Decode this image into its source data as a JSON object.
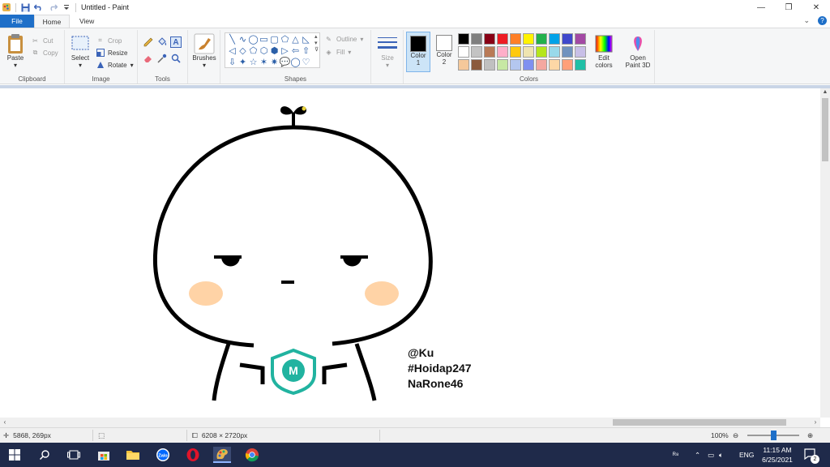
{
  "window": {
    "title": "Untitled - Paint",
    "controls": {
      "minimize": "—",
      "maximize": "❐",
      "close": "✕"
    }
  },
  "tabs": [
    {
      "label": "File"
    },
    {
      "label": "Home"
    },
    {
      "label": "View"
    }
  ],
  "ribbon": {
    "clipboard": {
      "label": "Clipboard",
      "paste": "Paste",
      "cut": "Cut",
      "copy": "Copy"
    },
    "image": {
      "label": "Image",
      "select": "Select",
      "crop": "Crop",
      "resize": "Resize",
      "rotate": "Rotate"
    },
    "tools": {
      "label": "Tools"
    },
    "brushes": {
      "label": "Brushes"
    },
    "shapes": {
      "label": "Shapes",
      "outline": "Outline",
      "fill": "Fill",
      "glyphs": [
        "╲",
        "∿",
        "◯",
        "▭",
        "▢",
        "⬠",
        "△",
        "◺",
        "◁",
        "◇",
        "⬠",
        "⬡",
        "⬢",
        "▷",
        "⇦",
        "⇧",
        "⇩",
        "✦",
        "☆",
        "✶",
        "✷",
        "💬",
        "◯",
        "♡"
      ]
    },
    "size": {
      "label": "Size"
    },
    "color1": {
      "label": "Color",
      "index": "1",
      "value": "#000000"
    },
    "color2": {
      "label": "Color",
      "index": "2",
      "value": "#ffffff"
    },
    "colors": {
      "label": "Colors",
      "palette": [
        "#000000",
        "#7f7f7f",
        "#880015",
        "#ed1c24",
        "#ff7f27",
        "#fff200",
        "#22b14c",
        "#00a2e8",
        "#3f48cc",
        "#a349a4",
        "#ffffff",
        "#c3c3c3",
        "#b97a57",
        "#ffaec9",
        "#ffc90e",
        "#efe4b0",
        "#b5e61d",
        "#99d9ea",
        "#7092be",
        "#c8bfe7",
        "#f5c89a",
        "#8b5a3c",
        "#c0c0c0",
        "#c7e8a3",
        "#b4c7ef",
        "#7f90f0",
        "#f4a8a0",
        "#fdd7a6",
        "#ffa07a",
        "#1fbfa6"
      ]
    },
    "edit_colors": {
      "line1": "Edit",
      "line2": "colors"
    },
    "paint3d": {
      "line1": "Open",
      "line2": "Paint 3D"
    }
  },
  "canvas": {
    "caption": [
      "@Ku",
      "#Hoidap247",
      "NaRone46"
    ],
    "badge_letter": "M",
    "colors": {
      "line": "#000000",
      "cheek": "#ffd3a6",
      "badge": "#21b3a0",
      "eye_highlight": "#e8d23a"
    }
  },
  "statusbar": {
    "cursor_pos": "5868, 269px",
    "image_size": "6208 × 2720px",
    "zoom": "100%"
  },
  "taskbar": {
    "apps": [
      "start-icon",
      "search-icon",
      "task-view-icon",
      "store-icon",
      "file-explorer-icon",
      "zalo-icon",
      "opera-icon",
      "paint-icon",
      "chrome-icon"
    ],
    "zalo_label": "Zalo",
    "language": "ENG",
    "time": "11:15 AM",
    "date": "6/25/2021",
    "notifications": "2"
  }
}
